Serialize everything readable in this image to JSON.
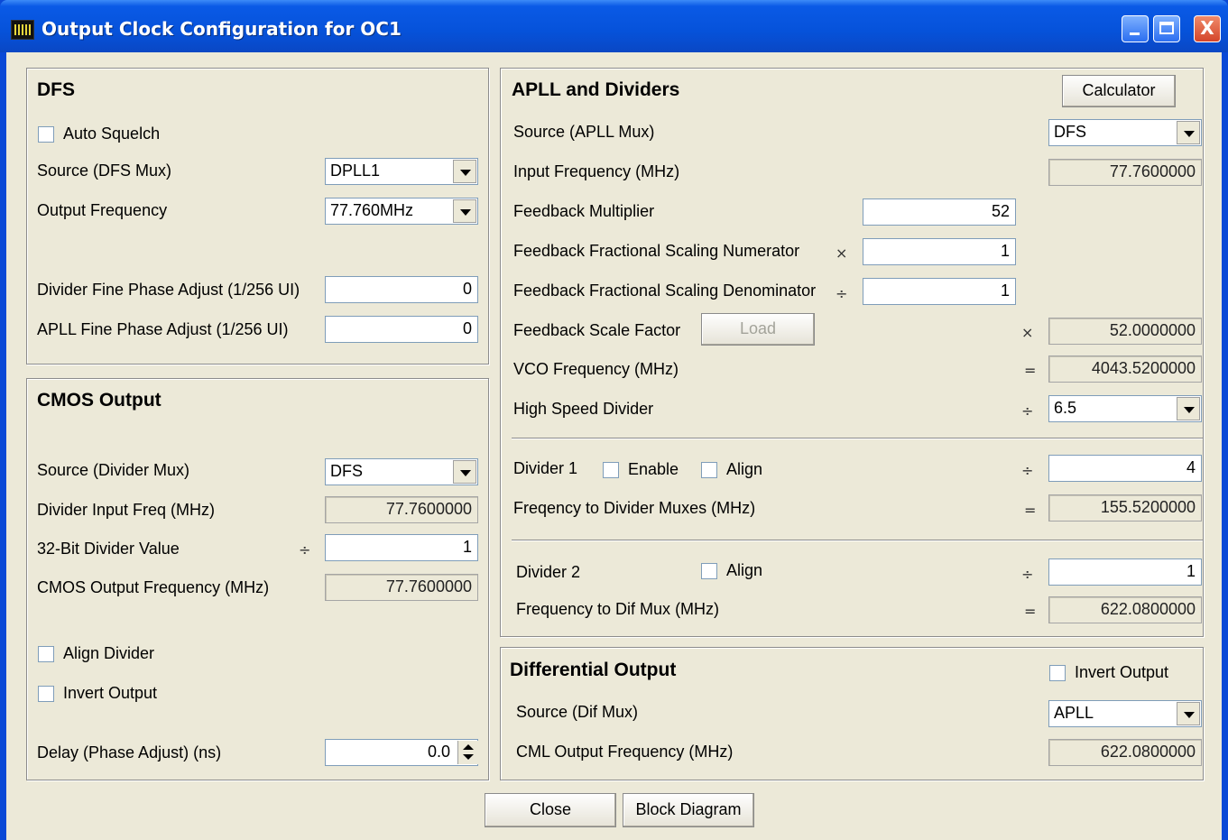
{
  "window": {
    "title": "Output Clock Configuration for OC1",
    "close_glyph": "X",
    "icons": {
      "minimize": "minimize-icon",
      "maximize": "maximize-icon",
      "close": "close-icon"
    }
  },
  "dfs": {
    "title": "DFS",
    "auto_squelch": "Auto Squelch",
    "source_label": "Source (DFS Mux)",
    "source_value": "DPLL1",
    "output_freq_label": "Output Frequency",
    "output_freq_value": "77.760MHz",
    "div_fine_label": "Divider Fine Phase Adjust (1/256 UI)",
    "div_fine_value": "0",
    "apll_fine_label": "APLL Fine Phase Adjust (1/256 UI)",
    "apll_fine_value": "0"
  },
  "cmos": {
    "title": "CMOS Output",
    "source_label": "Source (Divider Mux)",
    "source_value": "DFS",
    "div_input_label": "Divider Input Freq (MHz)",
    "div_input_value": "77.7600000",
    "div_value_label": "32-Bit Divider Value",
    "div_op": "÷",
    "div_value": "1",
    "out_freq_label": "CMOS Output Frequency (MHz)",
    "out_freq_value": "77.7600000",
    "align_divider": "Align Divider",
    "invert_output": "Invert Output",
    "delay_label": "Delay (Phase Adjust) (ns)",
    "delay_value": "0.0"
  },
  "apll": {
    "title": "APLL and Dividers",
    "calculator": "Calculator",
    "source_label": "Source (APLL Mux)",
    "source_value": "DFS",
    "input_freq_label": "Input Frequency (MHz)",
    "input_freq_value": "77.7600000",
    "fb_mult_label": "Feedback Multiplier",
    "fb_mult_value": "52",
    "fb_num_label": "Feedback Fractional Scaling Numerator",
    "fb_num_op": "×",
    "fb_num_value": "1",
    "fb_den_label": "Feedback Fractional Scaling Denominator",
    "fb_den_op": "÷",
    "fb_den_value": "1",
    "fb_scale_label": "Feedback Scale Factor",
    "load": "Load",
    "fb_scale_op": "×",
    "fb_scale_value": "52.0000000",
    "vco_label": "VCO Frequency (MHz)",
    "vco_op": "=",
    "vco_value": "4043.5200000",
    "hs_div_label": "High Speed Divider",
    "hs_div_op": "÷",
    "hs_div_value": "6.5",
    "div1_label": "Divider 1",
    "div1_enable": "Enable",
    "div1_align": "Align",
    "div1_op": "÷",
    "div1_value": "4",
    "freq_div_mux_label": "Freqency to Divider Muxes (MHz)",
    "freq_div_mux_op": "=",
    "freq_div_mux_value": "155.5200000",
    "div2_label": "Divider 2",
    "div2_align": "Align",
    "div2_op": "÷",
    "div2_value": "1",
    "freq_dif_label": "Frequency to Dif Mux (MHz)",
    "freq_dif_op": "=",
    "freq_dif_value": "622.0800000"
  },
  "diff": {
    "title": "Differential Output",
    "invert_output": "Invert Output",
    "source_label": "Source (Dif Mux)",
    "source_value": "APLL",
    "cml_label": "CML Output Frequency  (MHz)",
    "cml_value": "622.0800000"
  },
  "footer": {
    "close": "Close",
    "block_diagram": "Block Diagram"
  }
}
